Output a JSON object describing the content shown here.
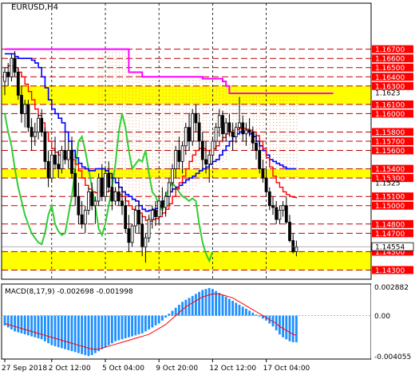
{
  "chart_data": {
    "type": "line",
    "title": "EURUSD,H4",
    "price_axis": {
      "levels": [
        1.167,
        1.166,
        1.165,
        1.164,
        1.163,
        1.161,
        1.16,
        1.158,
        1.157,
        1.156,
        1.154,
        1.153,
        1.151,
        1.15,
        1.148,
        1.147,
        1.145,
        1.143
      ],
      "level_labels": [
        "1.16700",
        "1.16600",
        "1.16500",
        "1.16400",
        "1.16300",
        "1.16100",
        "1.16000",
        "1.15800",
        "1.15700",
        "1.15600",
        "1.15400",
        "1.15300",
        "1.15100",
        "1.15000",
        "1.14800",
        "1.14700",
        "1.14500",
        "1.14300"
      ],
      "extra_ticks": [
        1.1623,
        1.1525
      ],
      "extra_tick_labels": [
        "1.1623",
        "1.1525"
      ],
      "current_price": 1.14554,
      "current_price_label": "1.14554",
      "ylim": [
        1.142,
        1.172
      ]
    },
    "highlight_zones": [
      {
        "from": 1.161,
        "to": 1.163
      },
      {
        "from": 1.153,
        "to": 1.154
      },
      {
        "from": 1.143,
        "to": 1.145
      }
    ],
    "time_axis": {
      "labels": [
        "27 Sep 2018",
        "2 Oct 12:00",
        "5 Oct 04:00",
        "9 Oct 20:00",
        "12 Oct 12:00",
        "17 Oct 04:00"
      ],
      "separators_at_bar": [
        14,
        30,
        46,
        62,
        78
      ]
    },
    "candles": [
      [
        1.1635,
        1.165,
        1.162,
        1.1645
      ],
      [
        1.1645,
        1.1655,
        1.163,
        1.164
      ],
      [
        1.164,
        1.1665,
        1.1635,
        1.166
      ],
      [
        1.166,
        1.1668,
        1.164,
        1.1645
      ],
      [
        1.1645,
        1.165,
        1.1615,
        1.162
      ],
      [
        1.162,
        1.163,
        1.159,
        1.16
      ],
      [
        1.16,
        1.1615,
        1.1585,
        1.161
      ],
      [
        1.161,
        1.1615,
        1.158,
        1.1585
      ],
      [
        1.1585,
        1.1595,
        1.156,
        1.1575
      ],
      [
        1.1575,
        1.159,
        1.1565,
        1.158
      ],
      [
        1.158,
        1.16,
        1.1572,
        1.1595
      ],
      [
        1.1595,
        1.1605,
        1.1575,
        1.158
      ],
      [
        1.158,
        1.1585,
        1.154,
        1.1548
      ],
      [
        1.1548,
        1.156,
        1.152,
        1.153
      ],
      [
        1.153,
        1.156,
        1.1525,
        1.1555
      ],
      [
        1.1555,
        1.1575,
        1.154,
        1.1545
      ],
      [
        1.1545,
        1.156,
        1.153,
        1.154
      ],
      [
        1.154,
        1.1565,
        1.1535,
        1.156
      ],
      [
        1.156,
        1.158,
        1.1545,
        1.155
      ],
      [
        1.155,
        1.157,
        1.154,
        1.156
      ],
      [
        1.156,
        1.1575,
        1.153,
        1.1535
      ],
      [
        1.1535,
        1.154,
        1.15,
        1.151
      ],
      [
        1.151,
        1.1525,
        1.148,
        1.149
      ],
      [
        1.149,
        1.1505,
        1.1475,
        1.148
      ],
      [
        1.148,
        1.15,
        1.147,
        1.1495
      ],
      [
        1.1495,
        1.152,
        1.149,
        1.1515
      ],
      [
        1.1515,
        1.1525,
        1.1495,
        1.15
      ],
      [
        1.15,
        1.151,
        1.148,
        1.1505
      ],
      [
        1.1505,
        1.1535,
        1.15,
        1.153
      ],
      [
        1.153,
        1.1545,
        1.1505,
        1.151
      ],
      [
        1.151,
        1.154,
        1.1505,
        1.1535
      ],
      [
        1.1535,
        1.1548,
        1.1515,
        1.152
      ],
      [
        1.152,
        1.1535,
        1.1495,
        1.1505
      ],
      [
        1.1505,
        1.152,
        1.15,
        1.1515
      ],
      [
        1.1515,
        1.153,
        1.15,
        1.1505
      ],
      [
        1.1505,
        1.152,
        1.149,
        1.15
      ],
      [
        1.15,
        1.151,
        1.147,
        1.1475
      ],
      [
        1.1475,
        1.149,
        1.145,
        1.146
      ],
      [
        1.146,
        1.148,
        1.1455,
        1.1478
      ],
      [
        1.1478,
        1.15,
        1.147,
        1.1495
      ],
      [
        1.1495,
        1.1505,
        1.147,
        1.148
      ],
      [
        1.148,
        1.149,
        1.1445,
        1.1455
      ],
      [
        1.1455,
        1.147,
        1.1438,
        1.1465
      ],
      [
        1.1465,
        1.149,
        1.146,
        1.1485
      ],
      [
        1.1485,
        1.15,
        1.1475,
        1.1495
      ],
      [
        1.1495,
        1.1505,
        1.1478,
        1.1488
      ],
      [
        1.1488,
        1.151,
        1.148,
        1.1505
      ],
      [
        1.1505,
        1.152,
        1.149,
        1.1498
      ],
      [
        1.1498,
        1.1515,
        1.1488,
        1.151
      ],
      [
        1.151,
        1.153,
        1.15,
        1.1525
      ],
      [
        1.1525,
        1.1545,
        1.1515,
        1.154
      ],
      [
        1.154,
        1.1565,
        1.153,
        1.156
      ],
      [
        1.156,
        1.1575,
        1.154,
        1.1548
      ],
      [
        1.1548,
        1.157,
        1.1535,
        1.1565
      ],
      [
        1.1565,
        1.159,
        1.1555,
        1.1585
      ],
      [
        1.1585,
        1.16,
        1.156,
        1.157
      ],
      [
        1.157,
        1.1605,
        1.1565,
        1.16
      ],
      [
        1.16,
        1.161,
        1.158,
        1.159
      ],
      [
        1.159,
        1.16,
        1.156,
        1.157
      ],
      [
        1.157,
        1.158,
        1.154,
        1.155
      ],
      [
        1.155,
        1.157,
        1.1535,
        1.1545
      ],
      [
        1.1545,
        1.156,
        1.1525,
        1.1555
      ],
      [
        1.1555,
        1.1575,
        1.1545,
        1.157
      ],
      [
        1.157,
        1.159,
        1.156,
        1.1585
      ],
      [
        1.1585,
        1.1605,
        1.1575,
        1.1598
      ],
      [
        1.1598,
        1.1603,
        1.157,
        1.1578
      ],
      [
        1.1578,
        1.1595,
        1.157,
        1.159
      ],
      [
        1.159,
        1.16,
        1.1575,
        1.158
      ],
      [
        1.158,
        1.159,
        1.156,
        1.1575
      ],
      [
        1.1575,
        1.159,
        1.1568,
        1.1585
      ],
      [
        1.1585,
        1.1618,
        1.158,
        1.159
      ],
      [
        1.159,
        1.1598,
        1.157,
        1.1578
      ],
      [
        1.1578,
        1.159,
        1.1565,
        1.1582
      ],
      [
        1.1582,
        1.1595,
        1.1575,
        1.158
      ],
      [
        1.158,
        1.1586,
        1.156,
        1.1568
      ],
      [
        1.1568,
        1.1578,
        1.155,
        1.156
      ],
      [
        1.156,
        1.157,
        1.1535,
        1.154
      ],
      [
        1.154,
        1.155,
        1.1525,
        1.153
      ],
      [
        1.153,
        1.154,
        1.151,
        1.1515
      ],
      [
        1.1515,
        1.152,
        1.1495,
        1.15
      ],
      [
        1.15,
        1.151,
        1.149,
        1.1498
      ],
      [
        1.1498,
        1.1505,
        1.148,
        1.1485
      ],
      [
        1.1485,
        1.15,
        1.148,
        1.1495
      ],
      [
        1.1495,
        1.1505,
        1.1488,
        1.15
      ],
      [
        1.15,
        1.151,
        1.148,
        1.1482
      ],
      [
        1.1482,
        1.149,
        1.146,
        1.1462
      ],
      [
        1.1462,
        1.147,
        1.1448,
        1.145
      ],
      [
        1.145,
        1.1462,
        1.1445,
        1.1455
      ]
    ],
    "indicators": {
      "ma_blue": [
        1.1665,
        1.1665,
        1.1665,
        1.1662,
        1.166,
        1.166,
        1.166,
        1.166,
        1.1658,
        1.1655,
        1.165,
        1.164,
        1.1628,
        1.1615,
        1.1605,
        1.16,
        1.1595,
        1.159,
        1.158,
        1.157,
        1.156,
        1.1552,
        1.1546,
        1.1542,
        1.154,
        1.1538,
        1.1538,
        1.154,
        1.154,
        1.154,
        1.1538,
        1.1535,
        1.153,
        1.1525,
        1.152,
        1.1515,
        1.1512,
        1.151,
        1.1507,
        1.1505,
        1.15,
        1.1496,
        1.1494,
        1.1495,
        1.1496,
        1.1497,
        1.15,
        1.1505,
        1.151,
        1.1515,
        1.1518,
        1.152,
        1.1522,
        1.1525,
        1.1528,
        1.153,
        1.1532,
        1.1535,
        1.1538,
        1.154,
        1.1542,
        1.1545,
        1.1548,
        1.155,
        1.1555,
        1.156,
        1.1565,
        1.157,
        1.1575,
        1.1578,
        1.158,
        1.158,
        1.158,
        1.1578,
        1.1575,
        1.157,
        1.1565,
        1.156,
        1.1555,
        1.155,
        1.1548,
        1.1546,
        1.1544,
        1.1542,
        1.154,
        1.154,
        1.154,
        1.154
      ],
      "ma_red": [
        1.165,
        1.1652,
        1.1652,
        1.165,
        1.1645,
        1.164,
        1.1632,
        1.1624,
        1.1615,
        1.1605,
        1.1598,
        1.159,
        1.158,
        1.157,
        1.1562,
        1.1558,
        1.1555,
        1.1553,
        1.1552,
        1.1552,
        1.155,
        1.1545,
        1.1538,
        1.153,
        1.1522,
        1.1518,
        1.1515,
        1.1514,
        1.1515,
        1.1514,
        1.1515,
        1.1516,
        1.1515,
        1.1513,
        1.1512,
        1.151,
        1.1505,
        1.15,
        1.1496,
        1.1494,
        1.1492,
        1.1488,
        1.1484,
        1.1483,
        1.1485,
        1.1486,
        1.1488,
        1.1492,
        1.1496,
        1.1502,
        1.151,
        1.1518,
        1.1525,
        1.1532,
        1.154,
        1.1548,
        1.1555,
        1.156,
        1.1562,
        1.1562,
        1.156,
        1.156,
        1.1562,
        1.1565,
        1.157,
        1.1574,
        1.1578,
        1.158,
        1.1582,
        1.1583,
        1.1584,
        1.1584,
        1.1583,
        1.1582,
        1.158,
        1.1576,
        1.157,
        1.1562,
        1.1552,
        1.1542,
        1.1532,
        1.1525,
        1.152,
        1.1515,
        1.1512,
        1.151,
        1.1509,
        1.1508
      ],
      "ma_magenta": [
        1.167,
        1.167,
        1.167,
        1.167,
        1.167,
        1.167,
        1.167,
        1.167,
        1.167,
        1.167,
        1.167,
        1.167,
        1.167,
        1.167,
        1.167,
        1.167,
        1.167,
        1.167,
        1.167,
        1.167,
        1.167,
        1.167,
        1.167,
        1.167,
        1.167,
        1.167,
        1.167,
        1.167,
        1.167,
        1.167,
        1.167,
        1.167,
        1.167,
        1.167,
        1.167,
        1.167,
        1.167,
        1.1645,
        1.1645,
        1.1645,
        1.1645,
        1.164,
        1.164,
        1.164,
        1.164,
        1.164,
        1.164,
        1.164,
        1.164,
        1.164,
        1.164,
        1.164,
        1.164,
        1.164,
        1.164,
        1.164,
        1.164,
        1.164,
        1.164,
        1.1638,
        1.1638,
        1.1638,
        1.1638,
        1.1638,
        1.1638,
        1.1635,
        1.163,
        1.1622,
        1.1622,
        1.1622,
        1.1622,
        1.1622,
        1.1622,
        1.1622,
        1.1622,
        1.1622,
        1.1622,
        1.1622,
        1.1622,
        1.1622,
        1.1622,
        1.1622,
        1.1622,
        1.1622,
        1.1622,
        1.1622,
        1.1622,
        1.1622,
        1.1622,
        1.1622,
        1.1622,
        1.1622,
        1.1622,
        1.1622,
        1.1622,
        1.1622,
        1.1622,
        1.1622,
        1.1622
      ],
      "green_line": [
        1.16,
        1.158,
        1.1565,
        1.154,
        1.152,
        1.1505,
        1.149,
        1.148,
        1.147,
        1.1465,
        1.146,
        1.1458,
        1.147,
        1.149,
        1.15,
        1.148,
        1.1472,
        1.1468,
        1.147,
        1.149,
        1.151,
        1.154,
        1.157,
        1.1575,
        1.156,
        1.154,
        1.152,
        1.15,
        1.1475,
        1.1468,
        1.148,
        1.15,
        1.152,
        1.1545,
        1.158,
        1.16,
        1.1585,
        1.156,
        1.154,
        1.1545,
        1.155,
        1.1548,
        1.156,
        1.1535,
        1.1515,
        1.151,
        1.15,
        1.1495,
        1.151,
        1.152,
        1.1525,
        1.152,
        1.1515,
        1.151,
        1.1508,
        1.1505,
        1.1508,
        1.1505,
        1.148,
        1.146,
        1.1448,
        1.144,
        1.145
      ]
    },
    "macd": {
      "label": "MACD(8,17,9) -0.002698 -0.001998",
      "axis_labels": [
        "0.002882",
        "0.00",
        "-0.004055"
      ],
      "ylim": [
        -0.0044,
        0.0032
      ],
      "histogram": [
        -0.001,
        -0.0012,
        -0.0014,
        -0.0016,
        -0.0017,
        -0.0018,
        -0.0019,
        -0.002,
        -0.0021,
        -0.0022,
        -0.0023,
        -0.0024,
        -0.0026,
        -0.0028,
        -0.003,
        -0.0031,
        -0.0032,
        -0.0033,
        -0.0034,
        -0.0035,
        -0.0036,
        -0.0037,
        -0.0038,
        -0.0039,
        -0.004,
        -0.0041,
        -0.004,
        -0.0038,
        -0.0036,
        -0.0034,
        -0.0032,
        -0.003,
        -0.0028,
        -0.0026,
        -0.0025,
        -0.0024,
        -0.0023,
        -0.0022,
        -0.0021,
        -0.002,
        -0.0019,
        -0.0018,
        -0.0016,
        -0.0014,
        -0.0012,
        -0.001,
        -0.0008,
        -0.0005,
        -0.0002,
        0.0002,
        0.0005,
        0.0008,
        0.0011,
        0.0014,
        0.0016,
        0.0018,
        0.002,
        0.0022,
        0.0024,
        0.0026,
        0.0027,
        0.0028,
        0.0027,
        0.0025,
        0.0023,
        0.0021,
        0.0019,
        0.0017,
        0.0015,
        0.0013,
        0.0011,
        0.0009,
        0.0007,
        0.0005,
        0.0003,
        0.0001,
        -0.0001,
        -0.0003,
        -0.0005,
        -0.0008,
        -0.0011,
        -0.0015,
        -0.0019,
        -0.0022,
        -0.0024,
        -0.0026,
        -0.0027,
        -0.0027
      ],
      "signal": [
        -0.0008,
        -0.0009,
        -0.001,
        -0.0011,
        -0.0012,
        -0.0013,
        -0.0014,
        -0.0015,
        -0.0016,
        -0.0017,
        -0.0018,
        -0.0019,
        -0.002,
        -0.0021,
        -0.0022,
        -0.0023,
        -0.0024,
        -0.0025,
        -0.0026,
        -0.0027,
        -0.0028,
        -0.0029,
        -0.003,
        -0.0031,
        -0.0032,
        -0.0033,
        -0.0034,
        -0.0034,
        -0.0034,
        -0.0033,
        -0.0032,
        -0.0031,
        -0.003,
        -0.0029,
        -0.0028,
        -0.0027,
        -0.0026,
        -0.0025,
        -0.0024,
        -0.0023,
        -0.0022,
        -0.0021,
        -0.002,
        -0.0019,
        -0.0017,
        -0.0015,
        -0.0013,
        -0.0011,
        -0.0009,
        -0.0006,
        -0.0003,
        0.0,
        0.0003,
        0.0006,
        0.0009,
        0.0011,
        0.0013,
        0.0015,
        0.0017,
        0.0019,
        0.002,
        0.0021,
        0.0022,
        0.0022,
        0.0022,
        0.0021,
        0.002,
        0.0019,
        0.0018,
        0.0016,
        0.0014,
        0.0012,
        0.001,
        0.0008,
        0.0006,
        0.0004,
        0.0002,
        0.0,
        -0.0002,
        -0.0004,
        -0.0006,
        -0.0008,
        -0.0011,
        -0.0013,
        -0.0015,
        -0.0017,
        -0.0019,
        -0.002
      ]
    },
    "colors": {
      "bull_candle": "#ffffff",
      "bear_candle": "#000000",
      "ma_blue": "#0000ff",
      "ma_red": "#ff0000",
      "ma_magenta": "#ff00ff",
      "green_line": "#32cd32",
      "zone": "#ffff00",
      "level_line": "#c00000",
      "level_label_bg": "#ff0000",
      "current_price_bg": "#ffffff",
      "macd_histogram": "#1e90ff",
      "macd_signal": "#ff0000"
    }
  }
}
